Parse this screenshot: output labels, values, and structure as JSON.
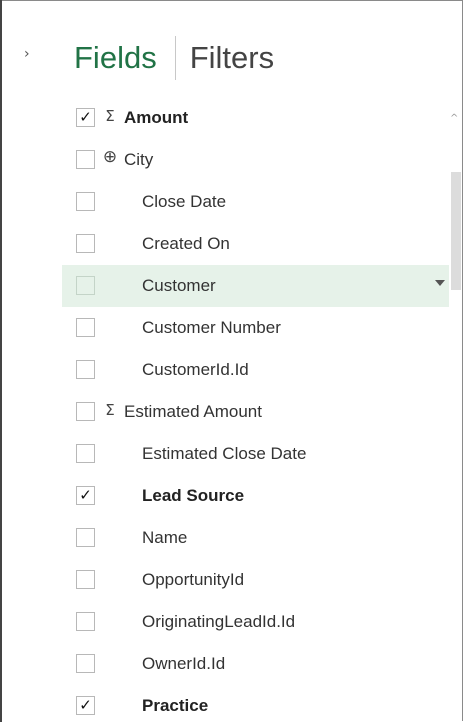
{
  "panel": {
    "tabs": {
      "fields": "Fields",
      "filters": "Filters"
    },
    "collapse_glyph": "›"
  },
  "fields": [
    {
      "label": "Amount",
      "checked": true,
      "type_icon": "Σ",
      "bold": true
    },
    {
      "label": "City",
      "checked": false,
      "type_icon": "⊕",
      "bold": false
    },
    {
      "label": "Close Date",
      "checked": false,
      "type_icon": "",
      "bold": false
    },
    {
      "label": "Created On",
      "checked": false,
      "type_icon": "",
      "bold": false
    },
    {
      "label": "Customer",
      "checked": false,
      "type_icon": "",
      "bold": false,
      "selected": true
    },
    {
      "label": "Customer Number",
      "checked": false,
      "type_icon": "",
      "bold": false
    },
    {
      "label": "CustomerId.Id",
      "checked": false,
      "type_icon": "",
      "bold": false
    },
    {
      "label": "Estimated Amount",
      "checked": false,
      "type_icon": "Σ",
      "bold": false
    },
    {
      "label": "Estimated Close Date",
      "checked": false,
      "type_icon": "",
      "bold": false
    },
    {
      "label": "Lead Source",
      "checked": true,
      "type_icon": "",
      "bold": true
    },
    {
      "label": "Name",
      "checked": false,
      "type_icon": "",
      "bold": false
    },
    {
      "label": "OpportunityId",
      "checked": false,
      "type_icon": "",
      "bold": false
    },
    {
      "label": "OriginatingLeadId.Id",
      "checked": false,
      "type_icon": "",
      "bold": false
    },
    {
      "label": "OwnerId.Id",
      "checked": false,
      "type_icon": "",
      "bold": false
    },
    {
      "label": "Practice",
      "checked": true,
      "type_icon": "",
      "bold": true
    }
  ],
  "colors": {
    "accent": "#217346",
    "selected_row": "#e6f2e9"
  },
  "scrollbar": {
    "up_glyph": "^"
  }
}
